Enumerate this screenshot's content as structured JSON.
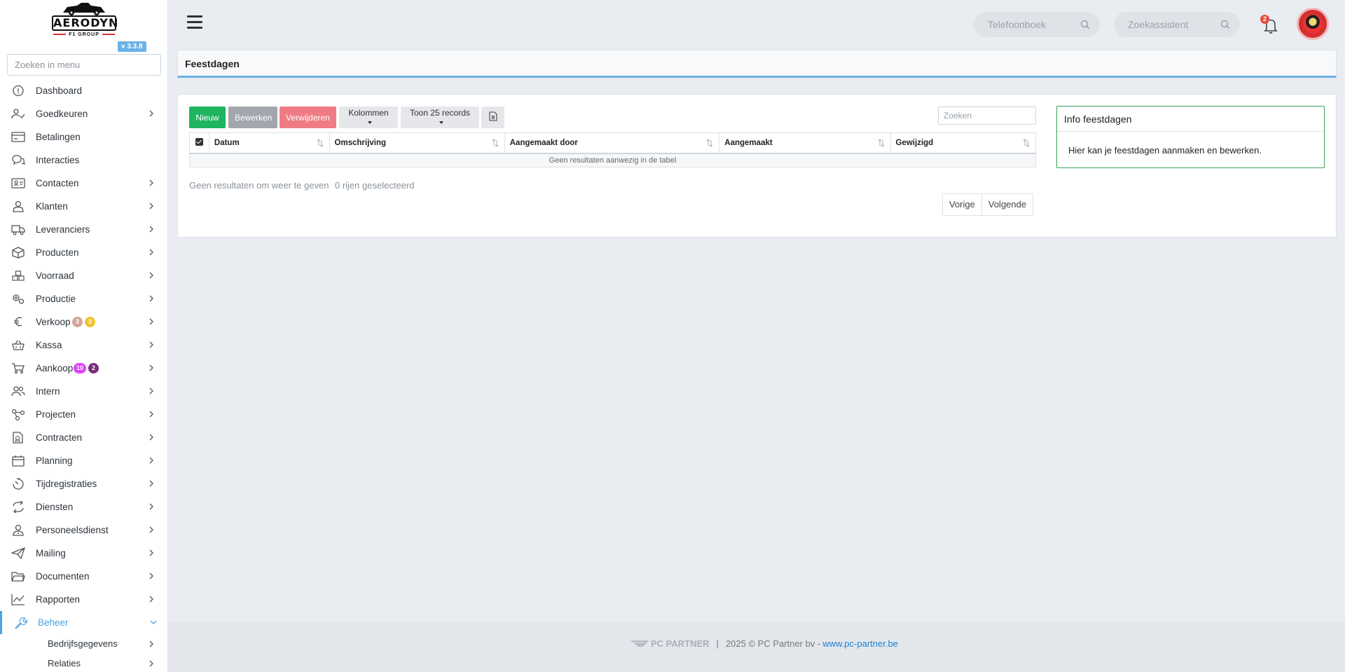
{
  "brand": {
    "logo_text": "AERODYN",
    "logo_sub": "F1 GROUP",
    "version": "v 3.3.8"
  },
  "sidebar": {
    "search_placeholder": "Zoeken in menu",
    "items": [
      {
        "label": "Dashboard",
        "icon": "dashboard-icon",
        "chevron": false
      },
      {
        "label": "Goedkeuren",
        "icon": "user-check-icon",
        "chevron": true
      },
      {
        "label": "Betalingen",
        "icon": "payment-icon",
        "chevron": false
      },
      {
        "label": "Interacties",
        "icon": "chat-icon",
        "chevron": false
      },
      {
        "label": "Contacten",
        "icon": "contact-card-icon",
        "chevron": true
      },
      {
        "label": "Klanten",
        "icon": "customer-icon",
        "chevron": true
      },
      {
        "label": "Leveranciers",
        "icon": "truck-icon",
        "chevron": true
      },
      {
        "label": "Producten",
        "icon": "box-icon",
        "chevron": true
      },
      {
        "label": "Voorraad",
        "icon": "stock-icon",
        "chevron": true
      },
      {
        "label": "Productie",
        "icon": "gears-icon",
        "chevron": true
      },
      {
        "label": "Verkoop",
        "icon": "euro-icon",
        "chevron": true,
        "badges": [
          {
            "text": "3",
            "color": "#d4a59a"
          },
          {
            "text": "3",
            "color": "#f1c232"
          }
        ]
      },
      {
        "label": "Kassa",
        "icon": "basket-icon",
        "chevron": true
      },
      {
        "label": "Aankoop",
        "icon": "cart-icon",
        "chevron": true,
        "badges": [
          {
            "text": "10",
            "color": "#e040fb"
          },
          {
            "text": "2",
            "color": "#7b2a7b"
          }
        ]
      },
      {
        "label": "Intern",
        "icon": "users-icon",
        "chevron": true
      },
      {
        "label": "Projecten",
        "icon": "project-icon",
        "chevron": true
      },
      {
        "label": "Contracten",
        "icon": "contract-icon",
        "chevron": true
      },
      {
        "label": "Planning",
        "icon": "calendar-icon",
        "chevron": true
      },
      {
        "label": "Tijdregistraties",
        "icon": "timer-icon",
        "chevron": true
      },
      {
        "label": "Diensten",
        "icon": "refresh-icon",
        "chevron": true
      },
      {
        "label": "Personeelsdienst",
        "icon": "personnel-icon",
        "chevron": true
      },
      {
        "label": "Mailing",
        "icon": "send-icon",
        "chevron": true
      },
      {
        "label": "Documenten",
        "icon": "folder-icon",
        "chevron": true
      },
      {
        "label": "Rapporten",
        "icon": "chart-icon",
        "chevron": true
      },
      {
        "label": "Beheer",
        "icon": "wrench-icon",
        "chevron": true,
        "active": true
      }
    ],
    "sub_items": [
      {
        "label": "Bedrijfsgegevens"
      },
      {
        "label": "Relaties"
      }
    ]
  },
  "header": {
    "phonebook_placeholder": "Telefoonboek",
    "assistant_placeholder": "Zoekassistent",
    "notification_count": "2"
  },
  "page": {
    "title": "Feestdagen"
  },
  "toolbar": {
    "new_label": "Nieuw",
    "edit_label": "Bewerken",
    "delete_label": "Verwijderen",
    "columns_label": "Kolommen",
    "show_label": "Toon 25 records",
    "search_placeholder": "Zoeken"
  },
  "table": {
    "columns": [
      "Datum",
      "Omschrijving",
      "Aangemaakt door",
      "Aangemaakt",
      "Gewijzigd"
    ],
    "empty_text": "Geen resultaten aanwezig in de tabel",
    "info_text": "Geen resultaten om weer te geven",
    "selected_text": "0 rijen geselecteerd",
    "prev_label": "Vorige",
    "next_label": "Volgende"
  },
  "info_card": {
    "title": "Info feestdagen",
    "body": "Hier kan je feestdagen aanmaken en bewerken."
  },
  "footer": {
    "logo_text": "PC PARTNER",
    "copyright": "2025 © PC Partner bv -",
    "link_text": "www.pc-partner.be"
  },
  "colors": {
    "accent": "#4aa3e3",
    "new_btn": "#1fb45f",
    "delete_btn": "#ef7c85",
    "edit_btn": "#a3a7ad",
    "info_border": "#3aa35a"
  }
}
